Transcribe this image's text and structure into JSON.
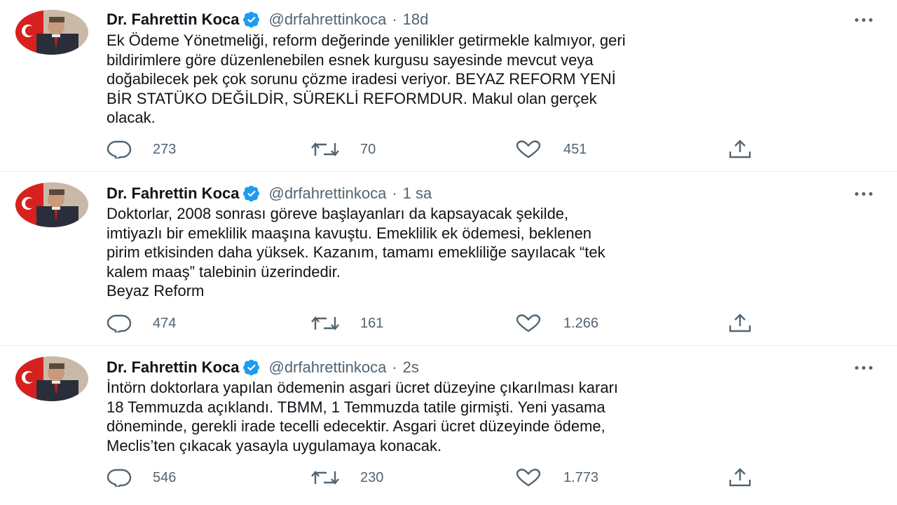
{
  "tweets": [
    {
      "name": "Dr. Fahrettin Koca",
      "handle": "@drfahrettinkoca",
      "separator": "·",
      "time": "18d",
      "lines": [
        "Ek Ödeme Yönetmeliği, reform değerinde yenilikler getirmekle kalmıyor, geri",
        "bildirimlere göre düzenlenebilen esnek kurgusu sayesinde mevcut veya",
        "doğabilecek pek çok sorunu çözme iradesi veriyor. BEYAZ REFORM YENİ",
        "BİR STATÜKO DEĞİLDİR, SÜREKLİ REFORMDUR. Makul olan gerçek",
        "olacak."
      ],
      "replies": "273",
      "retweets": "70",
      "likes": "451"
    },
    {
      "name": "Dr. Fahrettin Koca",
      "handle": "@drfahrettinkoca",
      "separator": "·",
      "time": "1 sa",
      "lines": [
        "Doktorlar, 2008 sonrası göreve başlayanları da kapsayacak şekilde,",
        "imtiyazlı bir emeklilik maaşına kavuştu. Emeklilik ek ödemesi, beklenen",
        "pirim etkisinden daha yüksek. Kazanım, tamamı emekliliğe sayılacak “tek",
        "kalem maaş” talebinin üzerindedir.",
        "Beyaz Reform"
      ],
      "replies": "474",
      "retweets": "161",
      "likes": "1.266"
    },
    {
      "name": "Dr. Fahrettin Koca",
      "handle": "@drfahrettinkoca",
      "separator": "·",
      "time": "2s",
      "lines": [
        "İntörn doktorlara yapılan ödemenin asgari ücret düzeyine çıkarılması kararı",
        "18 Temmuzda açıklandı. TBMM, 1 Temmuzda tatile girmişti. Yeni yasama",
        "döneminde, gerekli irade tecelli edecektir. Asgari ücret düzeyinde ödeme,",
        "Meclis’ten çıkacak yasayla uygulamaya konacak."
      ],
      "replies": "546",
      "retweets": "230",
      "likes": "1.773"
    }
  ],
  "icons": {
    "verified": "verified-badge-icon",
    "more": "more-options-icon",
    "reply": "reply-icon",
    "retweet": "retweet-icon",
    "like": "like-icon",
    "share": "share-icon"
  },
  "colors": {
    "text": "#0f1419",
    "secondary": "#536471",
    "verified": "#1d9bf0",
    "divider": "#e6ecf0"
  }
}
